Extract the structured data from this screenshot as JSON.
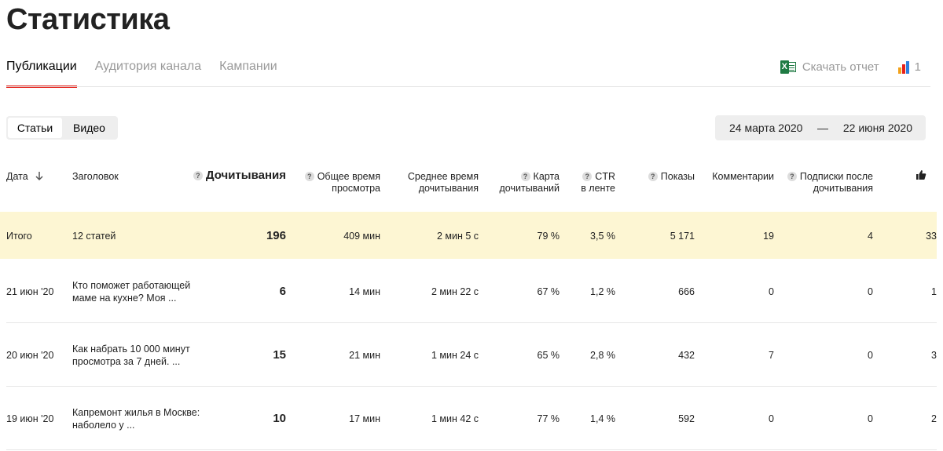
{
  "page_title": "Статистика",
  "tabs": [
    "Публикации",
    "Аудитория канала",
    "Кампании"
  ],
  "actions": {
    "download_label": "Скачать отчет",
    "excel_letter": "X",
    "stats_count": "1",
    "bar_colors": [
      "#f2a21b",
      "#e6211b",
      "#2c7fe0"
    ]
  },
  "segment": [
    "Статьи",
    "Видео"
  ],
  "date_range": {
    "from": "24 марта 2020",
    "dash": "—",
    "to": "22 июня 2020"
  },
  "columns": {
    "date": "Дата",
    "title": "Заголовок",
    "reads": "Дочитывания",
    "total_time_1": "Общее время",
    "total_time_2": "просмотра",
    "avg_time_1": "Среднее время",
    "avg_time_2": "дочитывания",
    "card_1": "Карта",
    "card_2": "дочитываний",
    "ctr_1": "CTR",
    "ctr_2": "в ленте",
    "views": "Показы",
    "comments": "Комментарии",
    "subs_1": "Подписки после",
    "subs_2": "дочитывания",
    "question_mark": "?"
  },
  "total": {
    "date": "Итого",
    "title": "12 статей",
    "reads": "196",
    "total_time": "409 мин",
    "avg_time": "2 мин 5 с",
    "card": "79 %",
    "ctr": "3,5 %",
    "views": "5 171",
    "comments": "19",
    "subs": "4",
    "likes": "33"
  },
  "rows": [
    {
      "date": "21 июн '20",
      "title_1": "Кто поможет работающей",
      "title_2": "маме на кухне? Моя ...",
      "reads": "6",
      "total_time": "14 мин",
      "avg_time": "2 мин 22 с",
      "card": "67 %",
      "ctr": "1,2 %",
      "views": "666",
      "comments": "0",
      "subs": "0",
      "likes": "1"
    },
    {
      "date": "20 июн '20",
      "title_1": "Как набрать 10 000 минут",
      "title_2": "просмотра за 7 дней. ...",
      "reads": "15",
      "total_time": "21 мин",
      "avg_time": "1 мин 24 с",
      "card": "65 %",
      "ctr": "2,8 %",
      "views": "432",
      "comments": "7",
      "subs": "0",
      "likes": "3"
    },
    {
      "date": "19 июн '20",
      "title_1": "Капремонт жилья в Москве:",
      "title_2": "наболело у ...",
      "reads": "10",
      "total_time": "17 мин",
      "avg_time": "1 мин 42 с",
      "card": "77 %",
      "ctr": "1,4 %",
      "views": "592",
      "comments": "0",
      "subs": "0",
      "likes": "2"
    }
  ]
}
